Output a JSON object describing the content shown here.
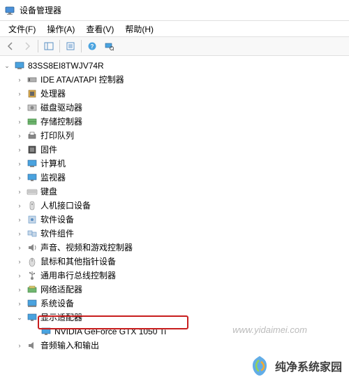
{
  "window": {
    "title": "设备管理器"
  },
  "menu": {
    "file": "文件(F)",
    "action": "操作(A)",
    "view": "查看(V)",
    "help": "帮助(H)"
  },
  "tree": {
    "root": "83SS8EI8TWJV74R",
    "categories": [
      {
        "id": "ide",
        "label": "IDE ATA/ATAPI 控制器",
        "icon": "ide"
      },
      {
        "id": "cpu",
        "label": "处理器",
        "icon": "cpu"
      },
      {
        "id": "disk",
        "label": "磁盘驱动器",
        "icon": "disk"
      },
      {
        "id": "storage",
        "label": "存储控制器",
        "icon": "storage"
      },
      {
        "id": "printq",
        "label": "打印队列",
        "icon": "printer"
      },
      {
        "id": "firmware",
        "label": "固件",
        "icon": "firmware"
      },
      {
        "id": "computer",
        "label": "计算机",
        "icon": "computer"
      },
      {
        "id": "monitor",
        "label": "监视器",
        "icon": "monitor"
      },
      {
        "id": "keyboard",
        "label": "键盘",
        "icon": "keyboard"
      },
      {
        "id": "hid",
        "label": "人机接口设备",
        "icon": "hid"
      },
      {
        "id": "softdev",
        "label": "软件设备",
        "icon": "softdev"
      },
      {
        "id": "softcomp",
        "label": "软件组件",
        "icon": "softcomp"
      },
      {
        "id": "sound",
        "label": "声音、视频和游戏控制器",
        "icon": "sound"
      },
      {
        "id": "mouse",
        "label": "鼠标和其他指针设备",
        "icon": "mouse"
      },
      {
        "id": "usb",
        "label": "通用串行总线控制器",
        "icon": "usb"
      },
      {
        "id": "network",
        "label": "网络适配器",
        "icon": "network"
      },
      {
        "id": "system",
        "label": "系统设备",
        "icon": "system"
      },
      {
        "id": "display",
        "label": "显示适配器",
        "icon": "display",
        "expanded": true,
        "children": [
          {
            "id": "gpu",
            "label": "NVIDIA GeForce GTX 1050 Ti",
            "icon": "display"
          }
        ]
      },
      {
        "id": "audio",
        "label": "音频输入和输出",
        "icon": "audio"
      }
    ]
  },
  "watermarks": {
    "url": "www.yidaimei.com",
    "brand": "纯净系统家园"
  }
}
